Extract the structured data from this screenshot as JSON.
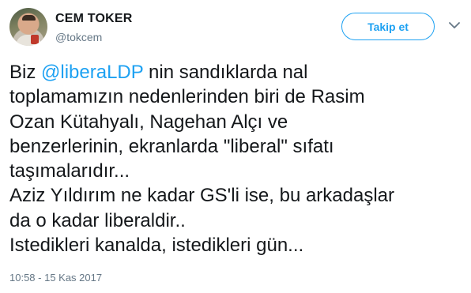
{
  "author": {
    "display_name": "CEM TOKER",
    "username": "@tokcem",
    "avatar_icon": "profile-photo"
  },
  "actions": {
    "follow_label": "Takip et",
    "menu_icon": "chevron-down-icon"
  },
  "tweet": {
    "lines": [
      {
        "before": "Biz ",
        "mention": "@liberaLDP",
        "after": " nin sandıklarda nal"
      },
      {
        "text": "toplamamızın nedenlerinden biri de Rasim"
      },
      {
        "text": "Ozan Kütahyalı, Nagehan Alçı ve"
      },
      {
        "text": "benzerlerinin, ekranlarda \"liberal\" sıfatı"
      },
      {
        "text": "taşımalarıdır..."
      },
      {
        "text": "Aziz Yıldırım ne kadar GS'li ise, bu arkadaşlar"
      },
      {
        "text": "da o kadar liberaldir.."
      },
      {
        "text": "Istedikleri kanalda, istedikleri gün..."
      }
    ],
    "timestamp": "10:58 - 15 Kas 2017"
  },
  "colors": {
    "accent": "#1da1f2",
    "text": "#14171a",
    "muted": "#657786"
  }
}
